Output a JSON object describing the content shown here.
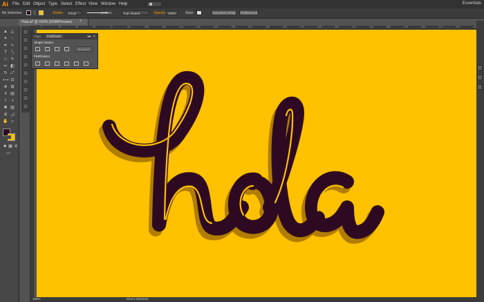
{
  "app": {
    "logo": "Ai",
    "workspace": "Essentials"
  },
  "menu": [
    "File",
    "Edit",
    "Object",
    "Type",
    "Select",
    "Effect",
    "View",
    "Window",
    "Help"
  ],
  "control": {
    "selection": "No Selection",
    "stroke_label": "Stroke:",
    "stroke_value": "0.5 pt",
    "profile": "Uniform",
    "brush": "5 pt. Round",
    "opacity_label": "Opacity:",
    "opacity_value": "100%",
    "style_label": "Style:",
    "doc_setup": "Document Setup",
    "preferences": "Preferences"
  },
  "document": {
    "tab_title": "Hola.ai* @ 150% (RGB/Preview)"
  },
  "ruler": [
    "0",
    "18",
    "36",
    "54",
    "72",
    "90",
    "108",
    "126",
    "144",
    "162",
    "180",
    "198",
    "216",
    "234",
    "252",
    "270",
    "288",
    "306",
    "324",
    "342",
    "360",
    "378",
    "396",
    "414",
    "432",
    "450"
  ],
  "pathfinder": {
    "tabs": [
      "Align",
      "Pathfinder"
    ],
    "shape_modes": "Shape Modes:",
    "expand": "Expand",
    "pathfinders": "Pathfinders:"
  },
  "artwork": {
    "text": "hola"
  },
  "status": {
    "zoom": "150%",
    "tool": "Direct Selection"
  },
  "colors": {
    "artboard": "#ffc100",
    "ink": "#2e0a22",
    "shadow": "#b07d00",
    "accent": "#ff9a00"
  }
}
